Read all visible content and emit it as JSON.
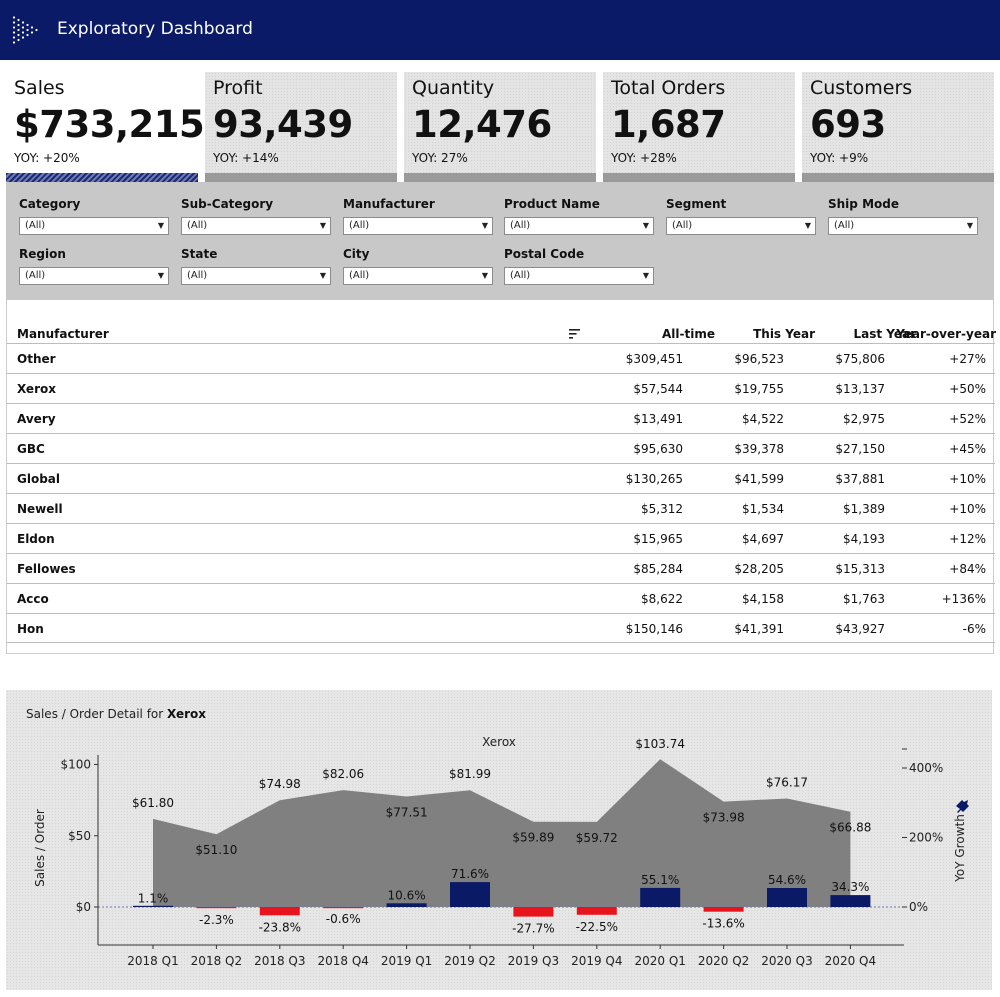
{
  "header": {
    "title": "Exploratory Dashboard"
  },
  "kpis": [
    {
      "label": "Sales",
      "value": "$733,215",
      "yoy": "YOY: +20%"
    },
    {
      "label": "Profit",
      "value": "93,439",
      "yoy": "YOY: +14%"
    },
    {
      "label": "Quantity",
      "value": "12,476",
      "yoy": "YOY: 27%"
    },
    {
      "label": "Total Orders",
      "value": "1,687",
      "yoy": "YOY: +28%"
    },
    {
      "label": "Customers",
      "value": "693",
      "yoy": "YOY: +9%"
    }
  ],
  "filters": [
    {
      "label": "Category",
      "value": "(All)"
    },
    {
      "label": "Sub-Category",
      "value": "(All)"
    },
    {
      "label": "Manufacturer",
      "value": "(All)"
    },
    {
      "label": "Product Name",
      "value": "(All)"
    },
    {
      "label": "Segment",
      "value": "(All)"
    },
    {
      "label": "Ship Mode",
      "value": "(All)"
    },
    {
      "label": "Region",
      "value": "(All)"
    },
    {
      "label": "State",
      "value": "(All)"
    },
    {
      "label": "City",
      "value": "(All)"
    },
    {
      "label": "Postal Code",
      "value": "(All)"
    }
  ],
  "table": {
    "headers": {
      "name": "Manufacturer",
      "all": "All-time",
      "this": "This Year",
      "last": "Last Year",
      "yoy": "Year-over-year"
    },
    "rows": [
      {
        "name": "Other",
        "all": "$309,451",
        "this": "$96,523",
        "last": "$75,806",
        "yoy": "+27%"
      },
      {
        "name": "Xerox",
        "all": "$57,544",
        "this": "$19,755",
        "last": "$13,137",
        "yoy": "+50%"
      },
      {
        "name": "Avery",
        "all": "$13,491",
        "this": "$4,522",
        "last": "$2,975",
        "yoy": "+52%"
      },
      {
        "name": "GBC",
        "all": "$95,630",
        "this": "$39,378",
        "last": "$27,150",
        "yoy": "+45%"
      },
      {
        "name": "Global",
        "all": "$130,265",
        "this": "$41,599",
        "last": "$37,881",
        "yoy": "+10%"
      },
      {
        "name": "Newell",
        "all": "$5,312",
        "this": "$1,534",
        "last": "$1,389",
        "yoy": "+10%"
      },
      {
        "name": "Eldon",
        "all": "$15,965",
        "this": "$4,697",
        "last": "$4,193",
        "yoy": "+12%"
      },
      {
        "name": "Fellowes",
        "all": "$85,284",
        "this": "$28,205",
        "last": "$15,313",
        "yoy": "+84%"
      },
      {
        "name": "Acco",
        "all": "$8,622",
        "this": "$4,158",
        "last": "$1,763",
        "yoy": "+136%"
      },
      {
        "name": "Hon",
        "all": "$150,146",
        "this": "$41,391",
        "last": "$43,927",
        "yoy": "-6%"
      }
    ]
  },
  "chart_panel": {
    "title_prefix": "Sales / Order Detail for ",
    "title_bold": "Xerox"
  },
  "chart_data": {
    "type": "area",
    "title": "Xerox",
    "ylabel": "Sales / Order",
    "y2label": "YoY Growth",
    "categories": [
      "2018 Q1",
      "2018 Q2",
      "2018 Q3",
      "2018 Q4",
      "2019 Q1",
      "2019 Q2",
      "2019 Q3",
      "2019 Q4",
      "2020 Q1",
      "2020 Q2",
      "2020 Q3",
      "2020 Q4"
    ],
    "series": [
      {
        "values": [
          61.8,
          51.1,
          74.98,
          82.06,
          77.51,
          81.99,
          59.89,
          59.72,
          103.74,
          73.98,
          76.17,
          66.88
        ],
        "labels": [
          "$61.80",
          "$51.10",
          "$74.98",
          "$82.06",
          "$77.51",
          "$81.99",
          "$59.89",
          "$59.72",
          "$103.74",
          "$73.98",
          "$76.17",
          "$66.88"
        ]
      },
      {
        "values": [
          1.1,
          -2.3,
          -23.8,
          -0.6,
          10.6,
          71.6,
          -27.7,
          -22.5,
          55.1,
          -13.6,
          54.6,
          34.3
        ],
        "labels": [
          "1.1%",
          "-2.3%",
          "-23.8%",
          "-0.6%",
          "10.6%",
          "71.6%",
          "-27.7%",
          "-22.5%",
          "55.1%",
          "-13.6%",
          "54.6%",
          "34.3%"
        ]
      }
    ],
    "yticks": [
      "$0",
      "$50",
      "$100"
    ],
    "yticks2": [
      "0%",
      "200%",
      "400%"
    ],
    "ylim": [
      0,
      100
    ],
    "y2lim": [
      0,
      400
    ],
    "colors": {
      "area": "#808080",
      "positive": "#0b1a66",
      "negative": "#e8141c"
    }
  }
}
